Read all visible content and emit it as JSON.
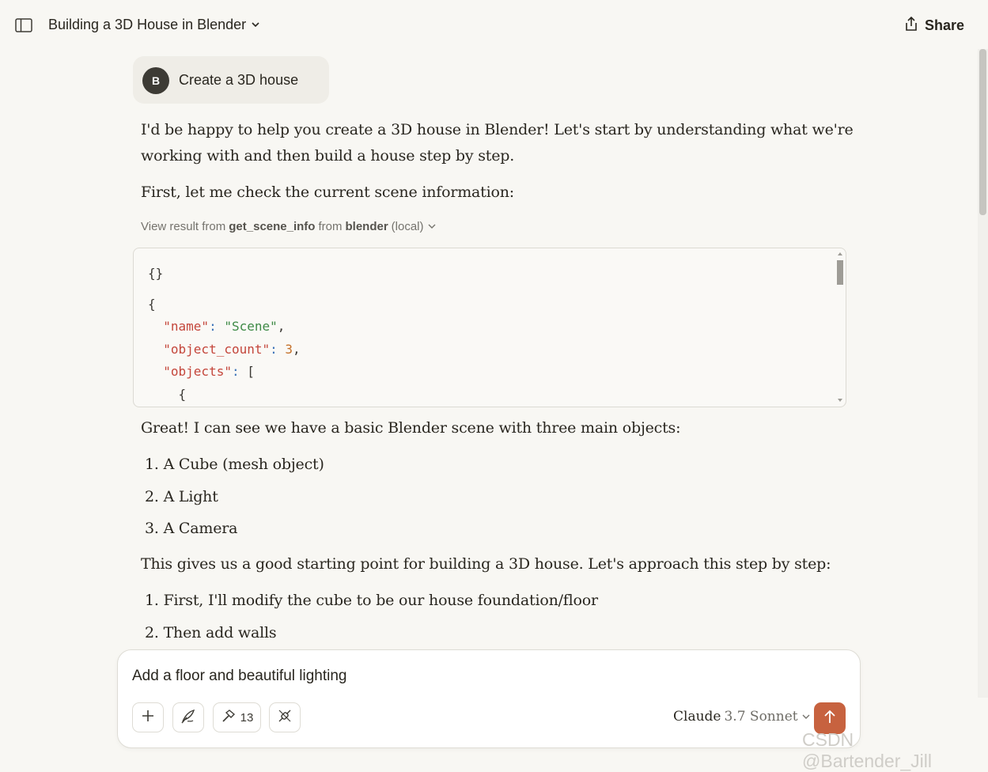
{
  "header": {
    "title": "Building a 3D House in Blender",
    "share_label": "Share"
  },
  "user_message": {
    "avatar_letter": "B",
    "text": "Create a 3D house"
  },
  "assistant": {
    "intro_line1": "I'd be happy to help you create a 3D house in Blender! Let's start by understanding what we're",
    "intro_line2": "working with and then build a house step by step.",
    "check_line": "First, let me check the current scene information:",
    "tool_result": {
      "prefix": "View result from",
      "tool": "get_scene_info",
      "from": "from",
      "server": "blender",
      "scope": "(local)"
    },
    "code": {
      "line1": "{}",
      "line2": "{",
      "key_name": "\"name\"",
      "val_name": "\"Scene\"",
      "key_count": "\"object_count\"",
      "val_count": "3",
      "key_objects": "\"objects\"",
      "bracket": "[",
      "brace": "{"
    },
    "great_line": "Great! I can see we have a basic Blender scene with three main objects:",
    "objects_list": [
      "1. A Cube (mesh object)",
      "2. A Light",
      "3. A Camera"
    ],
    "approach_line": "This gives us a good starting point for building a 3D house. Let's approach this step by step:",
    "steps_list": [
      "1. First, I'll modify the cube to be our house foundation/floor",
      "2. Then add walls"
    ]
  },
  "composer": {
    "input_value": "Add a floor and beautiful lighting",
    "tools_count": "13",
    "model_name": "Claude",
    "model_version": "3.7 Sonnet"
  },
  "watermark": "CSDN @Bartender_Jill",
  "colors": {
    "background": "#f8f7f3",
    "send_button": "#c7623f",
    "json_key": "#c4463b",
    "json_string": "#3e8a46",
    "json_number": "#c4712a"
  }
}
